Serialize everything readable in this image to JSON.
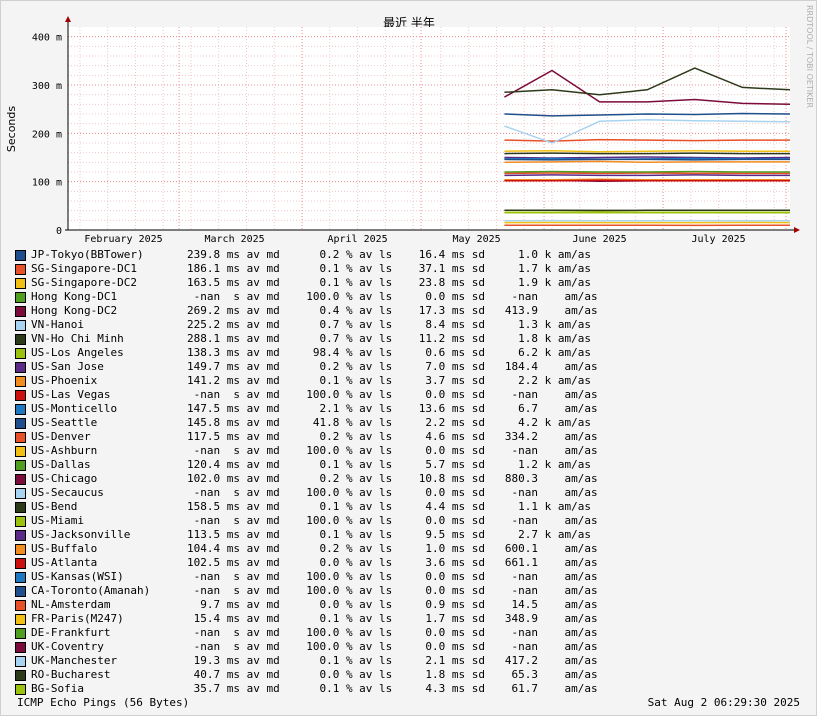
{
  "chart_data": {
    "type": "line",
    "title": "最近 半年",
    "ylabel": "Seconds",
    "watermark": "RRDTOOL / TOBI OETIKER",
    "y_ticks": [
      "0",
      "100 m",
      "200 m",
      "300 m",
      "400 m"
    ],
    "y_tick_values": [
      0,
      0.1,
      0.2,
      0.3,
      0.4
    ],
    "ylim": [
      0,
      0.42
    ],
    "x_labels": [
      "February 2025",
      "March 2025",
      "April 2025",
      "May 2025",
      "June 2025",
      "July 2025"
    ],
    "x_label_dates": [
      "2025-02-15",
      "2025-03-15",
      "2025-04-15",
      "2025-05-15",
      "2025-06-15",
      "2025-07-15"
    ],
    "xlim": [
      "2025-02-01",
      "2025-08-02"
    ],
    "data_start": "2025-05-22",
    "grid": true,
    "background": "#ffffff",
    "series": [
      {
        "name": "JP-Tokyo(BBTower)",
        "color": "#1f4e8c",
        "values": [
          0.24,
          0.236,
          0.238,
          0.24,
          0.239,
          0.241,
          0.24
        ]
      },
      {
        "name": "SG-Singapore-DC1",
        "color": "#e8502a",
        "values": [
          0.186,
          0.184,
          0.187,
          0.186,
          0.185,
          0.186,
          0.186
        ]
      },
      {
        "name": "SG-Singapore-DC2",
        "color": "#f2c012",
        "values": [
          0.163,
          0.164,
          0.162,
          0.163,
          0.164,
          0.163,
          0.163
        ]
      },
      {
        "name": "Hong Kong-DC1",
        "color": "#4f9e22",
        "values": []
      },
      {
        "name": "Hong Kong-DC2",
        "color": "#7a0b3a",
        "values": [
          0.275,
          0.33,
          0.265,
          0.265,
          0.27,
          0.262,
          0.26
        ]
      },
      {
        "name": "VN-Hanoi",
        "color": "#a8d4f2",
        "values": [
          0.215,
          0.18,
          0.225,
          0.228,
          0.226,
          0.225,
          0.224
        ]
      },
      {
        "name": "VN-Ho Chi Minh",
        "color": "#2d3a1a",
        "values": [
          0.285,
          0.29,
          0.28,
          0.29,
          0.335,
          0.295,
          0.29
        ]
      },
      {
        "name": "US-Los Angeles",
        "color": "#9cc210",
        "values": [
          0.04,
          0.04,
          0.039,
          0.04,
          0.04,
          0.04,
          0.04
        ]
      },
      {
        "name": "US-San Jose",
        "color": "#5a2a86",
        "values": [
          0.15,
          0.149,
          0.15,
          0.151,
          0.15,
          0.149,
          0.15
        ]
      },
      {
        "name": "US-Phoenix",
        "color": "#f28c1e",
        "values": [
          0.14,
          0.141,
          0.142,
          0.14,
          0.141,
          0.141,
          0.141
        ]
      },
      {
        "name": "US-Las Vegas",
        "color": "#cc1010",
        "values": []
      },
      {
        "name": "US-Monticello",
        "color": "#1f77c0",
        "values": [
          0.147,
          0.148,
          0.146,
          0.147,
          0.148,
          0.147,
          0.147
        ]
      },
      {
        "name": "US-Seattle",
        "color": "#1f4e8c",
        "values": [
          0.146,
          0.145,
          0.146,
          0.146,
          0.145,
          0.146,
          0.146
        ]
      },
      {
        "name": "US-Denver",
        "color": "#e8502a",
        "values": [
          0.117,
          0.118,
          0.117,
          0.118,
          0.117,
          0.117,
          0.117
        ]
      },
      {
        "name": "US-Ashburn",
        "color": "#f2c012",
        "values": []
      },
      {
        "name": "US-Dallas",
        "color": "#4f9e22",
        "values": [
          0.12,
          0.121,
          0.12,
          0.12,
          0.121,
          0.12,
          0.12
        ]
      },
      {
        "name": "US-Chicago",
        "color": "#7a0b3a",
        "values": [
          0.102,
          0.103,
          0.101,
          0.102,
          0.102,
          0.103,
          0.102
        ]
      },
      {
        "name": "US-Secaucus",
        "color": "#a8d4f2",
        "values": []
      },
      {
        "name": "US-Bend",
        "color": "#2d3a1a",
        "values": [
          0.158,
          0.159,
          0.158,
          0.158,
          0.159,
          0.158,
          0.158
        ]
      },
      {
        "name": "US-Miami",
        "color": "#9cc210",
        "values": []
      },
      {
        "name": "US-Jacksonville",
        "color": "#5a2a86",
        "values": [
          0.113,
          0.114,
          0.113,
          0.113,
          0.114,
          0.113,
          0.113
        ]
      },
      {
        "name": "US-Buffalo",
        "color": "#f28c1e",
        "values": [
          0.104,
          0.104,
          0.105,
          0.104,
          0.104,
          0.104,
          0.104
        ]
      },
      {
        "name": "US-Atlanta",
        "color": "#cc1010",
        "values": [
          0.102,
          0.102,
          0.103,
          0.102,
          0.102,
          0.102,
          0.102
        ]
      },
      {
        "name": "US-Kansas(WSI)",
        "color": "#1f77c0",
        "values": []
      },
      {
        "name": "CA-Toronto(Amanah)",
        "color": "#1f4e8c",
        "values": []
      },
      {
        "name": "NL-Amsterdam",
        "color": "#e8502a",
        "values": [
          0.0097,
          0.0098,
          0.0097,
          0.0097,
          0.0096,
          0.0097,
          0.0097
        ]
      },
      {
        "name": "FR-Paris(M247)",
        "color": "#f2c012",
        "values": [
          0.0154,
          0.0155,
          0.0153,
          0.0154,
          0.0154,
          0.0155,
          0.0154
        ]
      },
      {
        "name": "DE-Frankfurt",
        "color": "#4f9e22",
        "values": []
      },
      {
        "name": "UK-Coventry",
        "color": "#7a0b3a",
        "values": []
      },
      {
        "name": "UK-Manchester",
        "color": "#a8d4f2",
        "values": [
          0.0193,
          0.0195,
          0.0192,
          0.0193,
          0.0194,
          0.0193,
          0.0193
        ]
      },
      {
        "name": "RO-Bucharest",
        "color": "#2d3a1a",
        "values": [
          0.0407,
          0.0408,
          0.0406,
          0.0407,
          0.0408,
          0.0407,
          0.0407
        ]
      },
      {
        "name": "BG-Sofia",
        "color": "#9cc210",
        "values": [
          0.0357,
          0.0358,
          0.0356,
          0.0357,
          0.0358,
          0.0357,
          0.0357
        ]
      }
    ]
  },
  "legend": [
    {
      "name": "JP-Tokyo(BBTower)",
      "color": "#1f4e8c",
      "stats": "239.8 ms av md      0.2 % av ls    16.4 ms sd     1.0 k am/as"
    },
    {
      "name": "SG-Singapore-DC1",
      "color": "#e8502a",
      "stats": "186.1 ms av md      0.1 % av ls    37.1 ms sd     1.7 k am/as"
    },
    {
      "name": "SG-Singapore-DC2",
      "color": "#f2c012",
      "stats": "163.5 ms av md      0.1 % av ls    23.8 ms sd     1.9 k am/as"
    },
    {
      "name": "Hong Kong-DC1",
      "color": "#4f9e22",
      "stats": " -nan  s av md    100.0 % av ls     0.0 ms sd    -nan    am/as"
    },
    {
      "name": "Hong Kong-DC2",
      "color": "#7a0b3a",
      "stats": "269.2 ms av md      0.4 % av ls    17.3 ms sd   413.9    am/as"
    },
    {
      "name": "VN-Hanoi",
      "color": "#a8d4f2",
      "stats": "225.2 ms av md      0.7 % av ls     8.4 ms sd     1.3 k am/as"
    },
    {
      "name": "VN-Ho Chi Minh",
      "color": "#2d3a1a",
      "stats": "288.1 ms av md      0.7 % av ls    11.2 ms sd     1.8 k am/as"
    },
    {
      "name": "US-Los Angeles",
      "color": "#9cc210",
      "stats": "138.3 ms av md     98.4 % av ls     0.6 ms sd     6.2 k am/as"
    },
    {
      "name": "US-San Jose",
      "color": "#5a2a86",
      "stats": "149.7 ms av md      0.2 % av ls     7.0 ms sd   184.4    am/as"
    },
    {
      "name": "US-Phoenix",
      "color": "#f28c1e",
      "stats": "141.2 ms av md      0.1 % av ls     3.7 ms sd     2.2 k am/as"
    },
    {
      "name": "US-Las Vegas",
      "color": "#cc1010",
      "stats": " -nan  s av md    100.0 % av ls     0.0 ms sd    -nan    am/as"
    },
    {
      "name": "US-Monticello",
      "color": "#1f77c0",
      "stats": "147.5 ms av md      2.1 % av ls    13.6 ms sd     6.7    am/as"
    },
    {
      "name": "US-Seattle",
      "color": "#1f4e8c",
      "stats": "145.8 ms av md     41.8 % av ls     2.2 ms sd     4.2 k am/as"
    },
    {
      "name": "US-Denver",
      "color": "#e8502a",
      "stats": "117.5 ms av md      0.2 % av ls     4.6 ms sd   334.2    am/as"
    },
    {
      "name": "US-Ashburn",
      "color": "#f2c012",
      "stats": " -nan  s av md    100.0 % av ls     0.0 ms sd    -nan    am/as"
    },
    {
      "name": "US-Dallas",
      "color": "#4f9e22",
      "stats": "120.4 ms av md      0.1 % av ls     5.7 ms sd     1.2 k am/as"
    },
    {
      "name": "US-Chicago",
      "color": "#7a0b3a",
      "stats": "102.0 ms av md      0.2 % av ls    10.8 ms sd   880.3    am/as"
    },
    {
      "name": "US-Secaucus",
      "color": "#a8d4f2",
      "stats": " -nan  s av md    100.0 % av ls     0.0 ms sd    -nan    am/as"
    },
    {
      "name": "US-Bend",
      "color": "#2d3a1a",
      "stats": "158.5 ms av md      0.1 % av ls     4.4 ms sd     1.1 k am/as"
    },
    {
      "name": "US-Miami",
      "color": "#9cc210",
      "stats": " -nan  s av md    100.0 % av ls     0.0 ms sd    -nan    am/as"
    },
    {
      "name": "US-Jacksonville",
      "color": "#5a2a86",
      "stats": "113.5 ms av md      0.1 % av ls     9.5 ms sd     2.7 k am/as"
    },
    {
      "name": "US-Buffalo",
      "color": "#f28c1e",
      "stats": "104.4 ms av md      0.2 % av ls     1.0 ms sd   600.1    am/as"
    },
    {
      "name": "US-Atlanta",
      "color": "#cc1010",
      "stats": "102.5 ms av md      0.0 % av ls     3.6 ms sd   661.1    am/as"
    },
    {
      "name": "US-Kansas(WSI)",
      "color": "#1f77c0",
      "stats": " -nan  s av md    100.0 % av ls     0.0 ms sd    -nan    am/as"
    },
    {
      "name": "CA-Toronto(Amanah)",
      "color": "#1f4e8c",
      "stats": " -nan  s av md    100.0 % av ls     0.0 ms sd    -nan    am/as"
    },
    {
      "name": "NL-Amsterdam",
      "color": "#e8502a",
      "stats": "  9.7 ms av md      0.0 % av ls     0.9 ms sd    14.5    am/as"
    },
    {
      "name": "FR-Paris(M247)",
      "color": "#f2c012",
      "stats": " 15.4 ms av md      0.1 % av ls     1.7 ms sd   348.9    am/as"
    },
    {
      "name": "DE-Frankfurt",
      "color": "#4f9e22",
      "stats": " -nan  s av md    100.0 % av ls     0.0 ms sd    -nan    am/as"
    },
    {
      "name": "UK-Coventry",
      "color": "#7a0b3a",
      "stats": " -nan  s av md    100.0 % av ls     0.0 ms sd    -nan    am/as"
    },
    {
      "name": "UK-Manchester",
      "color": "#a8d4f2",
      "stats": " 19.3 ms av md      0.1 % av ls     2.1 ms sd   417.2    am/as"
    },
    {
      "name": "RO-Bucharest",
      "color": "#2d3a1a",
      "stats": " 40.7 ms av md      0.0 % av ls     1.8 ms sd    65.3    am/as"
    },
    {
      "name": "BG-Sofia",
      "color": "#9cc210",
      "stats": " 35.7 ms av md      0.1 % av ls     4.3 ms sd    61.7    am/as"
    }
  ],
  "footer": {
    "left": "ICMP Echo Pings (56 Bytes)",
    "right": "Sat Aug  2 06:29:30 2025"
  }
}
